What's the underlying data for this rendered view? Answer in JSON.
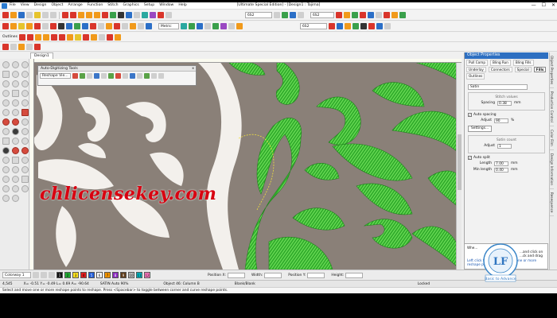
{
  "window": {
    "title": "[Ultimate Special Edition] - [Design1 : Tajima]",
    "menu": [
      "File",
      "View",
      "Design",
      "Object",
      "Arrange",
      "Function",
      "Stitch",
      "Graphics",
      "Setup",
      "Window",
      "Help"
    ],
    "controls": [
      "—",
      "☐",
      "✕"
    ]
  },
  "toolbar1": {
    "combo1": "6S2",
    "combo2": "6S2"
  },
  "toolbar2": {
    "units": "Metric",
    "combo": "6S2"
  },
  "toolbar3": {
    "label": "Outlines"
  },
  "doc_tab": {
    "label": "Design1"
  },
  "autodig": {
    "title": "Auto-Digitizing Tools",
    "sub": "Reshape Vie...",
    "close": "x"
  },
  "watermark": "chlicensekey.com",
  "object_properties": {
    "title": "Object Properties",
    "tabs": [
      "Pull Comp",
      "Bling Run",
      "Bling Fills",
      "Underlay",
      "Connectors",
      "Special",
      "Fills",
      "Outlines"
    ],
    "active_tab": "Fills",
    "fill_type": "Satin",
    "stitch_values_legend": "Stitch values",
    "spacing_label": "Spacing",
    "spacing_value": "0.38",
    "auto_spacing_label": "Auto spacing",
    "adjust_label": "Adjust",
    "adjust_value": "90",
    "adjust_unit": "%",
    "settings_button": "Settings...",
    "satin_count_legend": "Satin count",
    "satin_adjust_value": "1",
    "auto_split_label": "Auto split",
    "length_label": "Length",
    "length_value": "7.00",
    "min_length_label": "Min length",
    "min_length_value": "0.40",
    "unit_mm": "mm"
  },
  "right_strip": [
    "Object Properties",
    "Production Control",
    "Color Film",
    "Design Information",
    "Resequence"
  ],
  "help_panel": {
    "head": "Whe...",
    "lines": [
      "...and click on",
      "...ck and drag",
      "...rve reshape",
      "...add a curve",
      "...reshape",
      "Left click to select and move one or more reshape point.",
      "Press <Spacebar> to toggle between corner and curve reshape points."
    ],
    "checkbox": "Do not show this tip again"
  },
  "logo": {
    "initials": "LF",
    "ring_text": "Laptrinh From...",
    "caption": "Basic to Advance"
  },
  "colorbar": {
    "colorway": "Colorway 1",
    "swatches": [
      {
        "label": "1",
        "color": "#111111"
      },
      {
        "label": "2",
        "color": "#22aa33"
      },
      {
        "label": "3",
        "color": "#fbe021"
      },
      {
        "label": "4",
        "color": "#e21d1d"
      },
      {
        "label": "5",
        "color": "#1f5bd6"
      },
      {
        "label": "6",
        "color": "#ffffff"
      },
      {
        "label": "7",
        "color": "#f29400"
      },
      {
        "label": "8",
        "color": "#8b2bbf"
      },
      {
        "label": "9",
        "color": "#5e3c1b"
      },
      {
        "label": "10",
        "color": "#c0c0c0"
      },
      {
        "label": "11",
        "color": "#00b7c3"
      },
      {
        "label": "12",
        "color": "#ff7ac2"
      }
    ],
    "pos_x_label": "Position X:",
    "pos_y_label": "Position Y:",
    "width_label": "Width:",
    "height_label": "Height:"
  },
  "status": {
    "stitches": "4,545",
    "coords": "X= -0.51  Y= -0.49  L= 0.69  A= -90.64",
    "object": "SATIN Auto 90%",
    "obj_index": "Object 46: Column B",
    "blank": "Blank/Blank",
    "locked": "Locked"
  },
  "hint": "Select and move one or more reshape points to reshape. Press <Spacebar> to toggle between corner and curve reshape points."
}
